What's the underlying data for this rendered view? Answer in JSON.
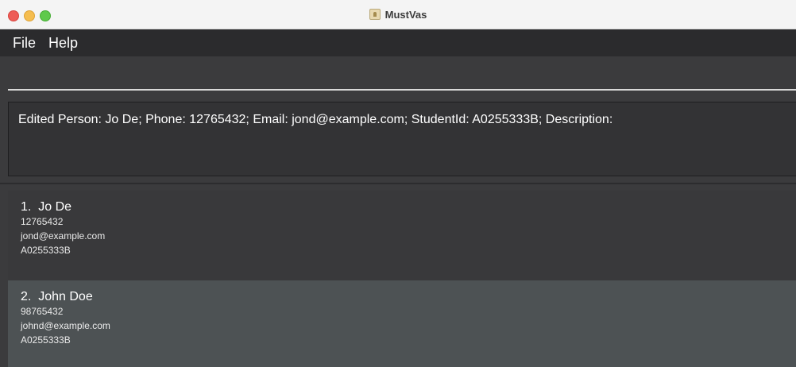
{
  "window": {
    "title": "MustVas",
    "icon": "app-icon"
  },
  "menu": {
    "items": [
      {
        "label": "File"
      },
      {
        "label": "Help"
      }
    ]
  },
  "command": {
    "value": "",
    "placeholder": ""
  },
  "result": {
    "text": "Edited Person: Jo De; Phone: 12765432; Email: jond@example.com; StudentId: A0255333B; Description:"
  },
  "persons": [
    {
      "index": "1.",
      "name": "Jo De",
      "phone": "12765432",
      "email": "jond@example.com",
      "student_id": "A0255333B"
    },
    {
      "index": "2.",
      "name": "John Doe",
      "phone": "98765432",
      "email": "johnd@example.com",
      "student_id": "A0255333B"
    }
  ],
  "colors": {
    "background": "#3b3b3d",
    "menubar": "#2b2b2d",
    "card_odd": "#39393b",
    "card_even": "#4d5254",
    "text": "#ffffff"
  }
}
